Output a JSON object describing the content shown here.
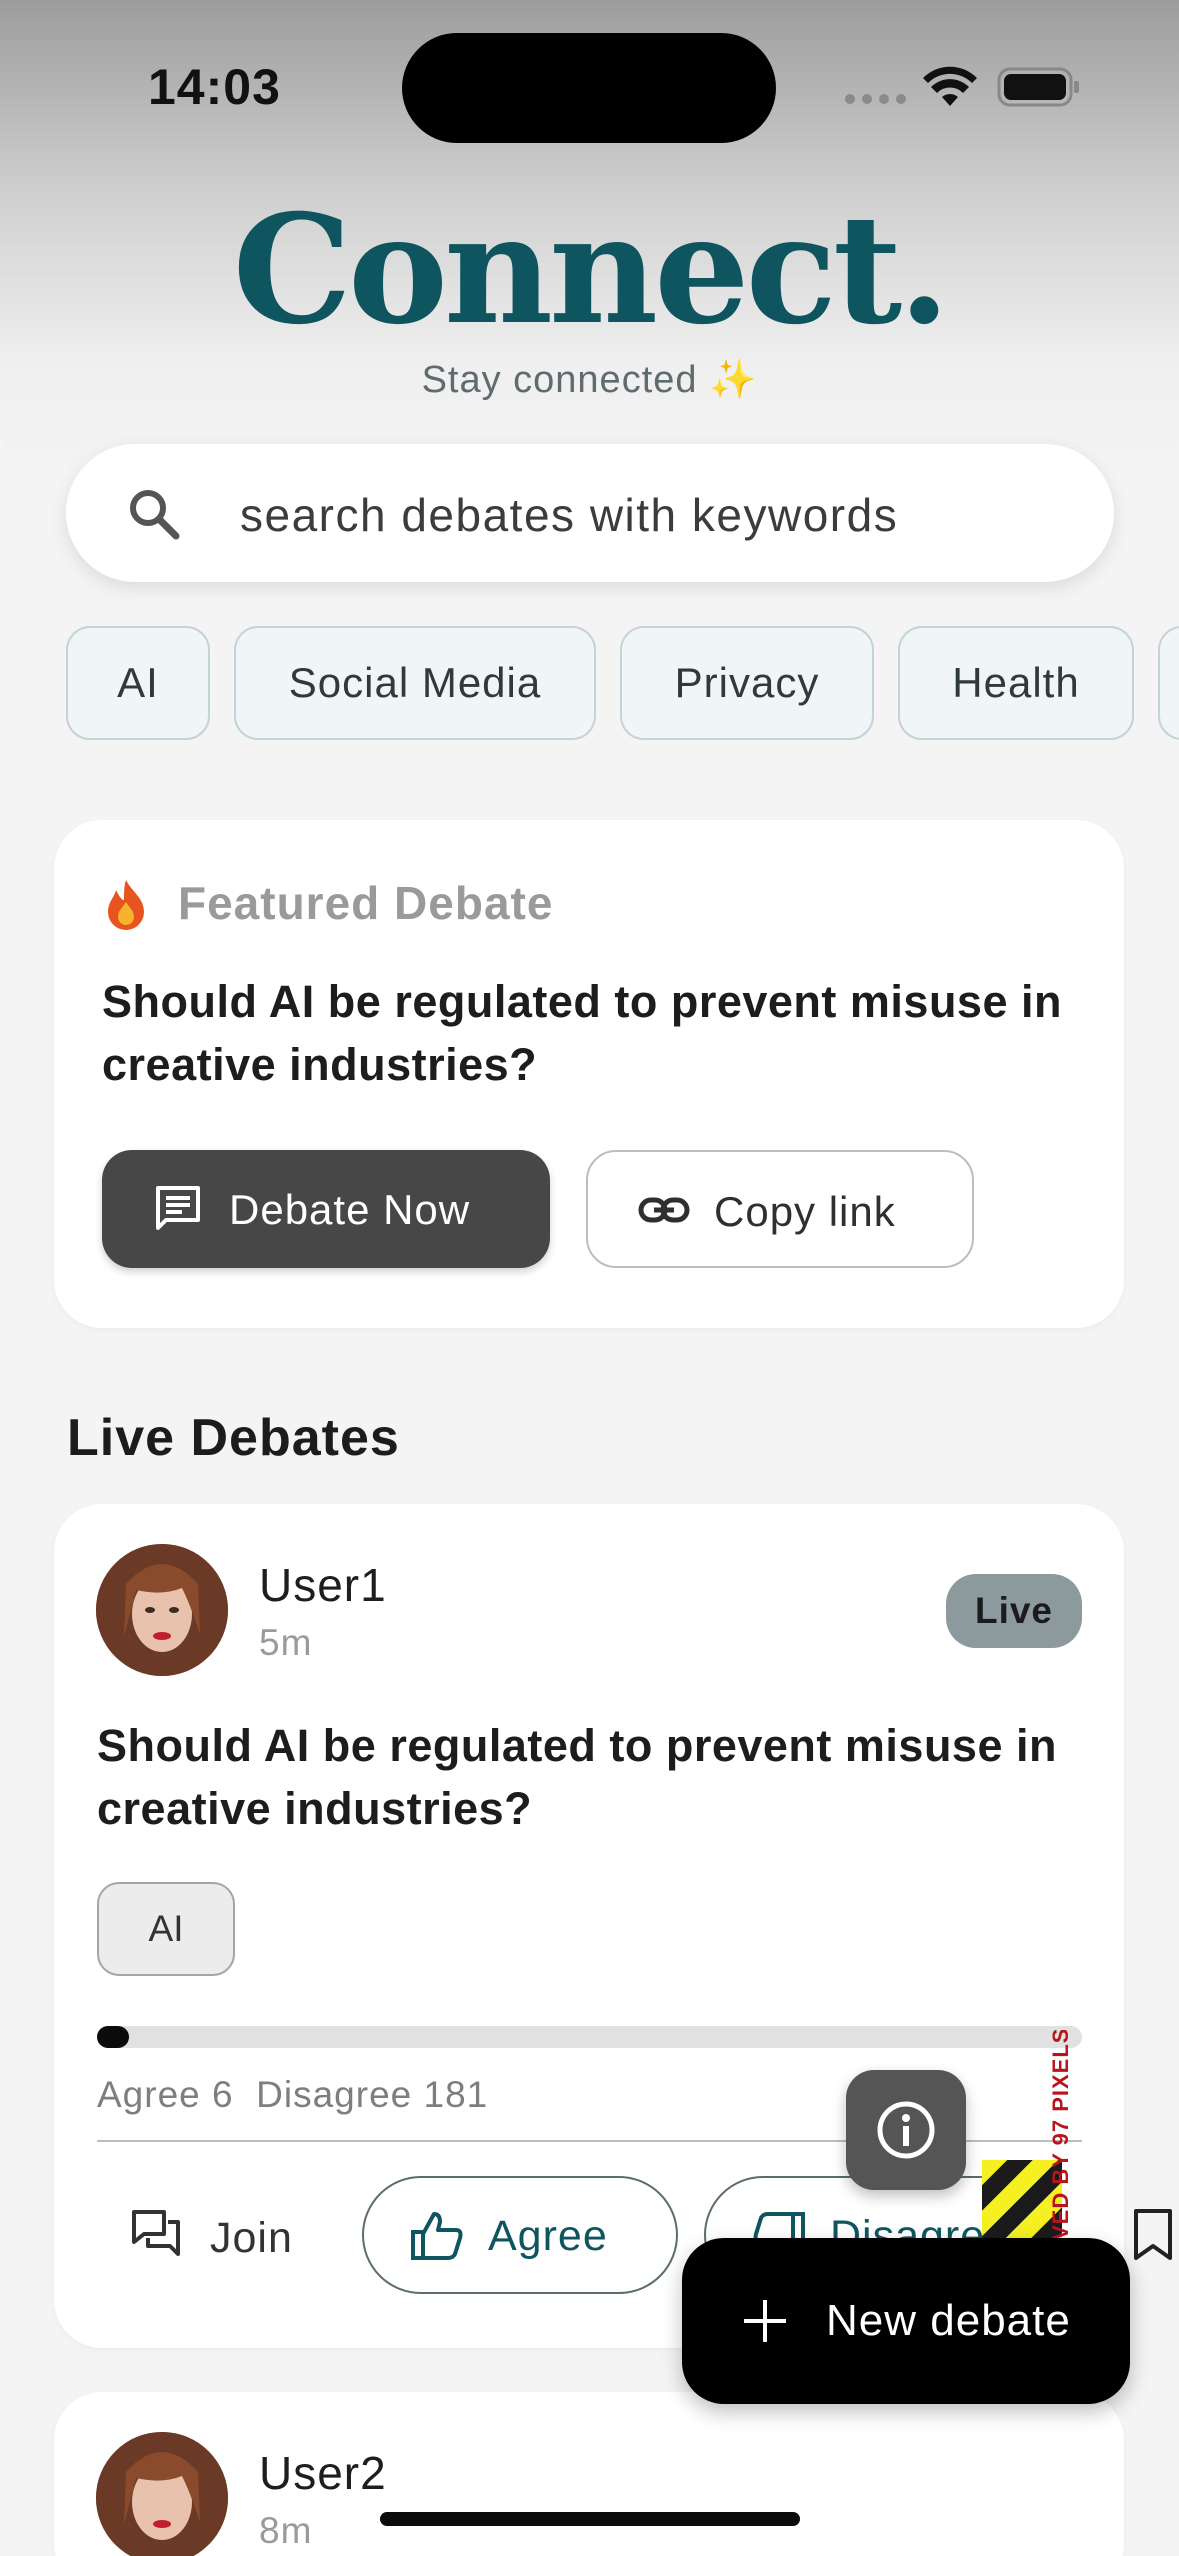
{
  "status_bar": {
    "time": "14:03"
  },
  "brand": {
    "title": "Connect.",
    "tagline": "Stay connected",
    "tagline_emoji": "✨",
    "color": "#0f5560"
  },
  "search": {
    "placeholder": "search debates with keywords"
  },
  "categories": [
    "AI",
    "Social Media",
    "Privacy",
    "Health"
  ],
  "featured": {
    "label": "Featured Debate",
    "question": "Should AI be regulated to prevent misuse in creative industries?",
    "debate_button": "Debate Now",
    "copy_button": "Copy link"
  },
  "live_section": {
    "title": "Live Debates"
  },
  "posts": [
    {
      "user": "User1",
      "time": "5m",
      "badge": "Live",
      "question": "Should AI be regulated to prevent misuse in creative industries?",
      "tag": "AI",
      "agree_count_label": "Agree 6",
      "disagree_count_label": "Disagree 181",
      "agree_count": 6,
      "disagree_count": 181,
      "agree_fraction": 0.032,
      "join_label": "Join",
      "agree_label": "Agree",
      "disagree_label": "Disagree"
    },
    {
      "user": "User2",
      "time": "8m"
    }
  ],
  "watermark": {
    "text": "VED BY 97 PIXELS"
  },
  "fab": {
    "new_debate": "New debate"
  }
}
